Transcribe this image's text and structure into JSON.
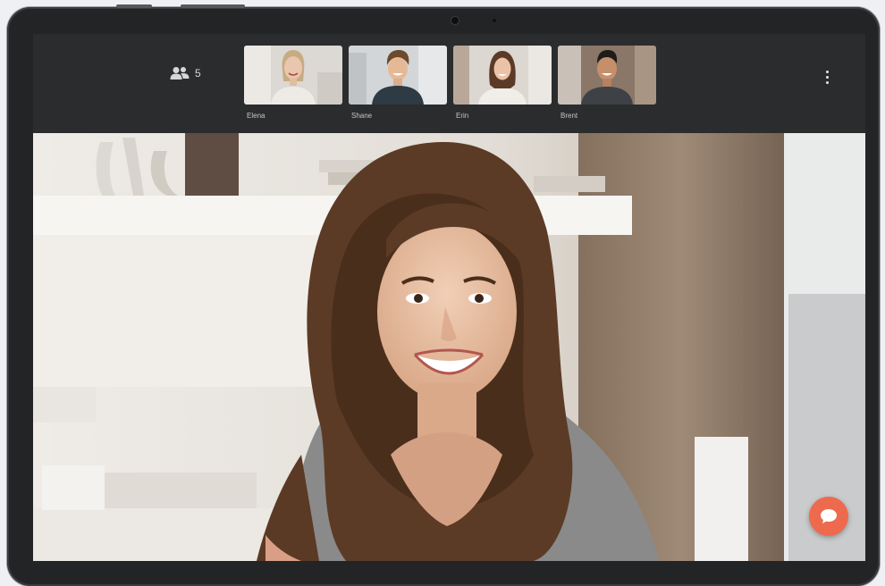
{
  "call": {
    "participant_count": "5",
    "participants": [
      {
        "name": "Elena",
        "bg": "#d8d4cf",
        "hair": "#c9b08a",
        "shirt": "#e9e6e2"
      },
      {
        "name": "Shane",
        "bg": "#cfd2d4",
        "hair": "#6b4a2e",
        "shirt": "#2f3b45"
      },
      {
        "name": "Erin",
        "bg": "#d9d3cf",
        "hair": "#5a3a26",
        "shirt": "#f0ece8"
      },
      {
        "name": "Brent",
        "bg": "#8c7a6b",
        "hair": "#1e1a17",
        "shirt": "#3e4247"
      }
    ]
  },
  "icons": {
    "participants": "people-icon",
    "more": "more-vertical-icon",
    "chat": "chat-bubble-icon"
  },
  "colors": {
    "accent": "#ee6a4e",
    "topbar": "#2b2c2e",
    "bezel": "#232426"
  }
}
